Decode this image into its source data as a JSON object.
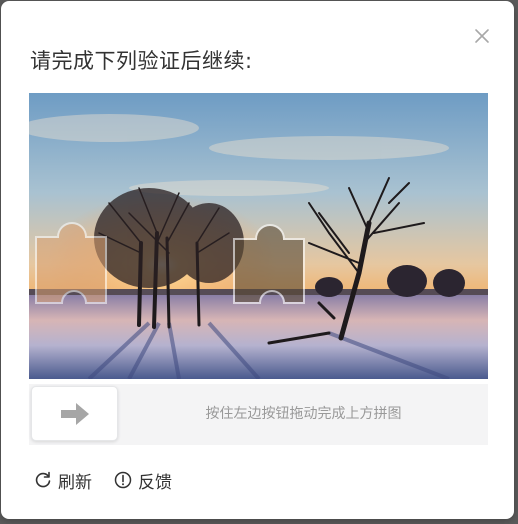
{
  "dialog": {
    "title": "请完成下列验证后继续:",
    "close_icon": "close-icon"
  },
  "captcha": {
    "image_description_icon": "winter-sunset-landscape",
    "slider_hint": "按住左边按钮拖动完成上方拼图",
    "handle_icon": "arrow-right-icon"
  },
  "footer": {
    "refresh_label": "刷新",
    "refresh_icon": "refresh-icon",
    "feedback_label": "反馈",
    "feedback_icon": "info-circle-icon"
  },
  "colors": {
    "accent_text": "#333333",
    "hint_text": "#999999",
    "track_bg": "#f4f4f5"
  }
}
